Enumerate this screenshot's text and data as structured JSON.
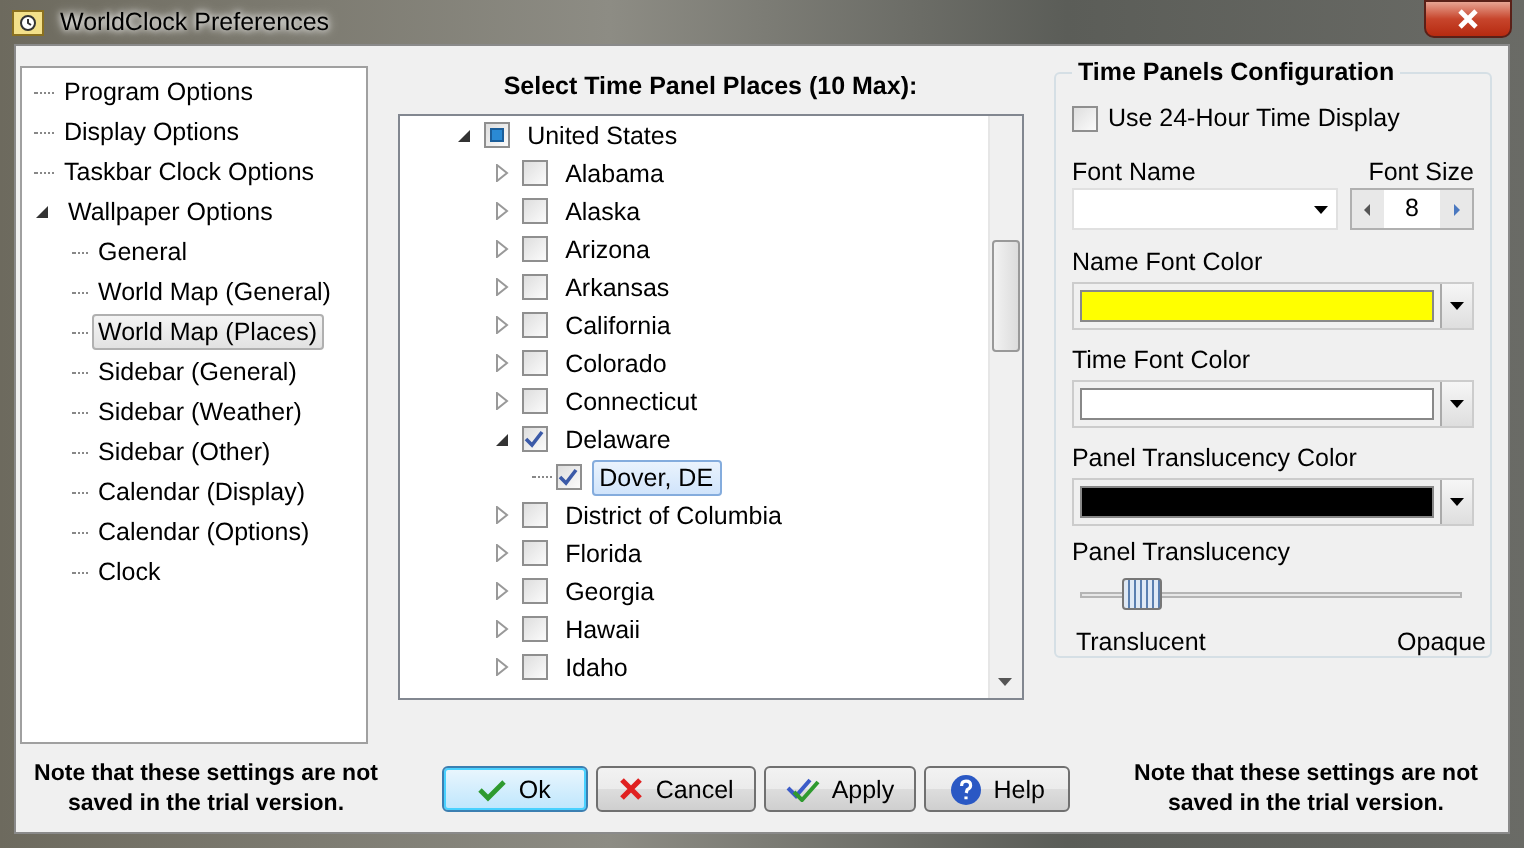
{
  "window": {
    "title": "WorldClock Preferences"
  },
  "nav": [
    {
      "label": "Program Options",
      "selected": false
    },
    {
      "label": "Display Options",
      "selected": false
    },
    {
      "label": "Taskbar Clock Options",
      "selected": false
    },
    {
      "label": "Wallpaper Options",
      "selected": false,
      "expanded": true,
      "children": [
        {
          "label": "General",
          "selected": false
        },
        {
          "label": "World Map (General)",
          "selected": false
        },
        {
          "label": "World Map (Places)",
          "selected": true
        },
        {
          "label": "Sidebar (General)",
          "selected": false
        },
        {
          "label": "Sidebar (Weather)",
          "selected": false
        },
        {
          "label": "Sidebar (Other)",
          "selected": false
        },
        {
          "label": "Calendar (Display)",
          "selected": false
        },
        {
          "label": "Calendar (Options)",
          "selected": false
        },
        {
          "label": "Clock",
          "selected": false
        }
      ]
    }
  ],
  "places": {
    "title": "Select Time Panel Places (10 Max):",
    "tree": [
      {
        "label": "United States",
        "indeterminate": true,
        "expanded": true,
        "selected": false,
        "children": [
          {
            "label": "Alabama",
            "checked": false,
            "expanded": false,
            "selected": false
          },
          {
            "label": "Alaska",
            "checked": false,
            "expanded": false,
            "selected": false
          },
          {
            "label": "Arizona",
            "checked": false,
            "expanded": false,
            "selected": false
          },
          {
            "label": "Arkansas",
            "checked": false,
            "expanded": false,
            "selected": false
          },
          {
            "label": "California",
            "checked": false,
            "expanded": false,
            "selected": false
          },
          {
            "label": "Colorado",
            "checked": false,
            "expanded": false,
            "selected": false
          },
          {
            "label": "Connecticut",
            "checked": false,
            "expanded": false,
            "selected": false
          },
          {
            "label": "Delaware",
            "checked": true,
            "expanded": true,
            "selected": false,
            "children": [
              {
                "label": "Dover, DE",
                "checked": true,
                "selected": true
              }
            ]
          },
          {
            "label": "District of Columbia",
            "checked": false,
            "expanded": false,
            "selected": false
          },
          {
            "label": "Florida",
            "checked": false,
            "expanded": false,
            "selected": false
          },
          {
            "label": "Georgia",
            "checked": false,
            "expanded": false,
            "selected": false
          },
          {
            "label": "Hawaii",
            "checked": false,
            "expanded": false,
            "selected": false
          },
          {
            "label": "Idaho",
            "checked": false,
            "expanded": false,
            "selected": false
          }
        ]
      }
    ]
  },
  "config": {
    "title": "Time Panels Configuration",
    "use24": {
      "label": "Use 24-Hour Time Display",
      "checked": false
    },
    "font_name": {
      "label": "Font Name"
    },
    "font_size": {
      "label": "Font Size",
      "value": "8"
    },
    "colors": [
      {
        "label": "Name Font Color",
        "color": "#ffff00"
      },
      {
        "label": "Time Font Color",
        "color": "#ffffff"
      },
      {
        "label": "Panel Translucency Color",
        "color": "#000000"
      }
    ],
    "translucency": {
      "label": "Panel Translucency",
      "level": 0.16,
      "min_label": "Translucent",
      "max_label": "Opaque"
    }
  },
  "notes": [
    "Note that these settings are not saved in the trial version.",
    "Note that these settings are not saved in the trial version."
  ],
  "buttons": [
    {
      "label": "Ok",
      "kind": "ok"
    },
    {
      "label": "Cancel",
      "kind": "cancel"
    },
    {
      "label": "Apply",
      "kind": "apply"
    },
    {
      "label": "Help",
      "kind": "help"
    }
  ]
}
